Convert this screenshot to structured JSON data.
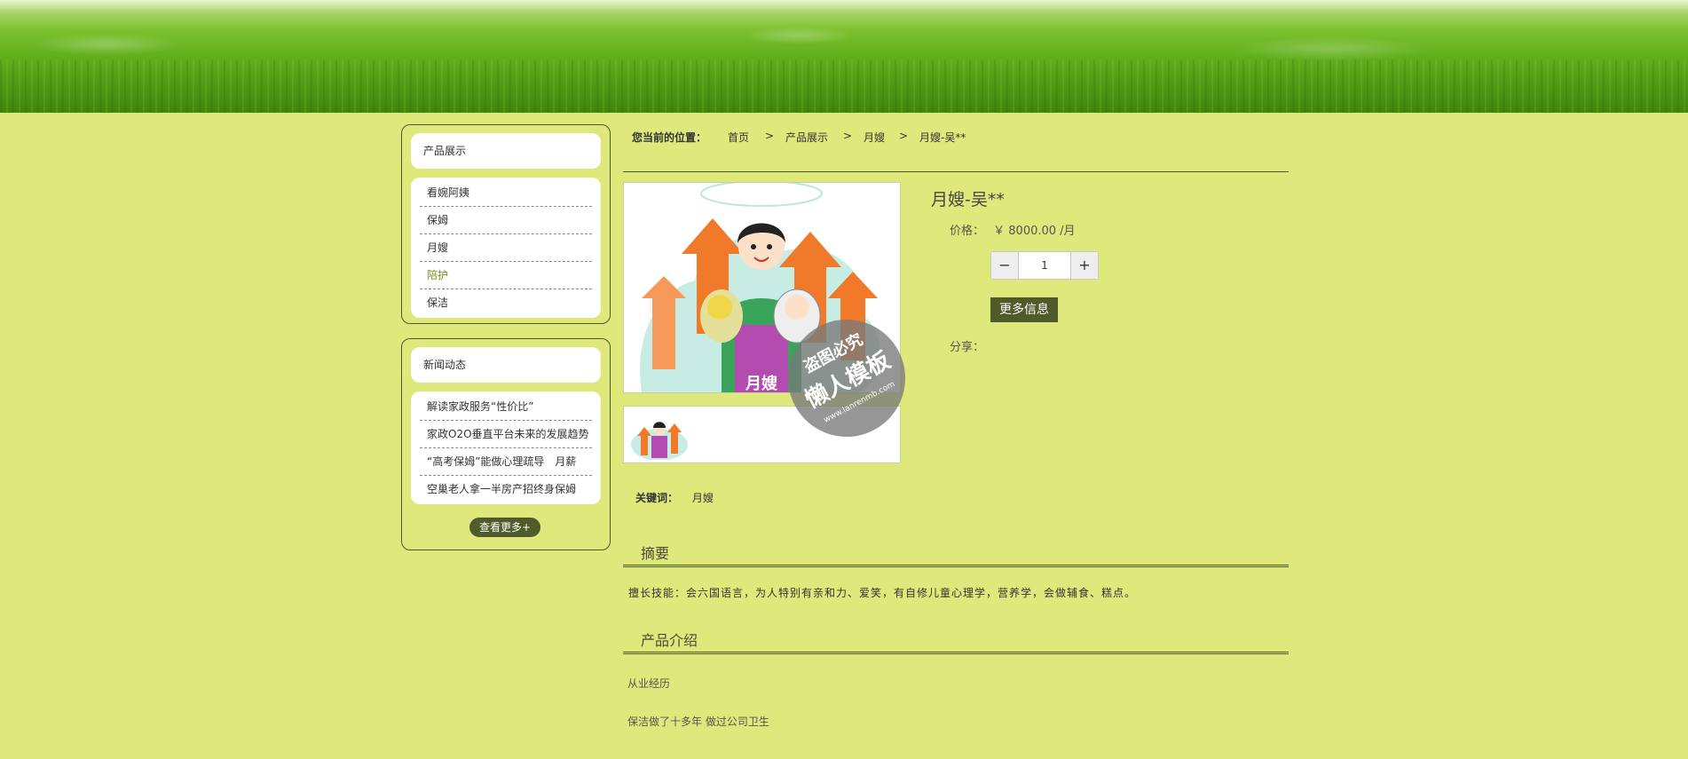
{
  "sidebar": {
    "products": {
      "title": "产品展示",
      "items": [
        "看婉阿姨",
        "保姆",
        "月嫂",
        "陪护",
        "保洁"
      ],
      "active_index": 3
    },
    "news": {
      "title": "新闻动态",
      "items": [
        "解读家政服务“性价比”",
        "家政O2O垂直平台未来的发展趋势",
        "“高考保姆”能做心理疏导　月薪",
        "空巢老人拿一半房产招终身保姆"
      ],
      "more_label": "查看更多+"
    }
  },
  "breadcrumb": {
    "prefix": "您当前的位置：",
    "items": [
      "首页",
      "产品展示",
      "月嫂",
      "月嫂-吴**"
    ],
    "separator": ">"
  },
  "product": {
    "title": "月嫂-吴**",
    "price_label": "价格：",
    "price_value": "￥ 8000.00 /月",
    "quantity": "1",
    "minus_label": "−",
    "plus_label": "+",
    "more_info_label": "更多信息",
    "share_label": "分享：",
    "keywords_label": "关键词：",
    "keywords_value": "月嫂",
    "image_caption": "月嫂"
  },
  "summary": {
    "heading": "摘要",
    "text": "擅长技能：会六国语言，为人特别有亲和力、爱笑，有自修儿童心理学，营养学，会做辅食、糕点。"
  },
  "intro": {
    "heading": "产品介绍",
    "line1": "从业经历",
    "line2": "保洁做了十多年 做过公司卫生"
  },
  "watermark": {
    "line1": "盗图必究",
    "line2": "懒人模板",
    "line3": "www.lanrenmb.com"
  },
  "colors": {
    "page_bg": "#dfe87a",
    "dark_button": "#4f5b2b",
    "active_link": "#7a8f1a"
  }
}
